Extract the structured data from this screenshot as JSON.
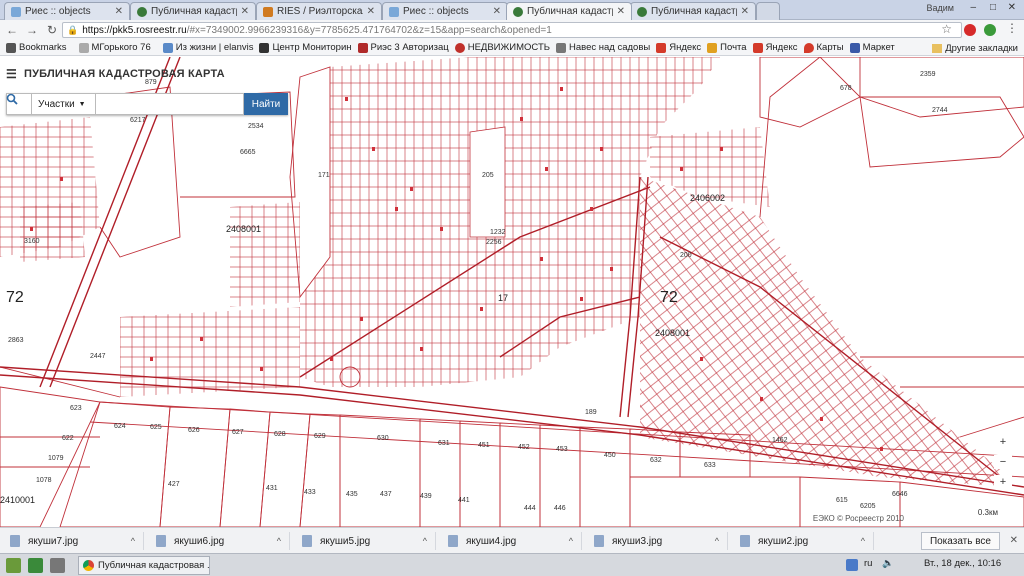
{
  "browser": {
    "tabs": [
      {
        "label": "Риес :: objects",
        "icon": "ries"
      },
      {
        "label": "Публичная кадастро",
        "icon": "rosreestr"
      },
      {
        "label": "RIES / Риэлторская и",
        "icon": "ries"
      },
      {
        "label": "Риес :: objects",
        "icon": "ries"
      },
      {
        "label": "Публичная кадастро",
        "icon": "rosreestr",
        "active": true
      },
      {
        "label": "Публичная кадастро",
        "icon": "rosreestr"
      }
    ],
    "user": "Вадим",
    "url_host": "https://pkk5.rosreestr.ru",
    "url_rest": "/#x=7349002.9966239316&y=7785625.471764702&z=15&app=search&opened=1",
    "bookmarks": [
      {
        "label": "Bookmarks",
        "icon": "apps-icon"
      },
      {
        "label": "МГорького 76",
        "icon": "doc-icon"
      },
      {
        "label": "Из жизни | elanvis",
        "icon": "blog-icon"
      },
      {
        "label": "Центр Мониторин",
        "icon": "monitor-icon"
      },
      {
        "label": "Риэс 3 Авторизац",
        "icon": "ries-icon"
      },
      {
        "label": "НЕДВИЖИМОСТЬ",
        "icon": "realty-icon"
      },
      {
        "label": "Навес над садовы",
        "icon": "tool-icon"
      },
      {
        "label": "Яндекс",
        "icon": "yandex-icon"
      },
      {
        "label": "Почта",
        "icon": "mail-icon"
      },
      {
        "label": "Яндекс",
        "icon": "yandex-icon"
      },
      {
        "label": "Карты",
        "icon": "maps-icon"
      },
      {
        "label": "Маркет",
        "icon": "market-icon"
      }
    ],
    "other_bookmarks": "Другие закладки"
  },
  "app": {
    "title": "ПУБЛИЧНАЯ КАДАСТРОВАЯ КАРТА",
    "search_type": "Участки",
    "search_value": "",
    "search_button": "Найти",
    "copyright": "ЕЭКО © Росреестр 2010",
    "scale": "0.3км",
    "zoom_in": "+",
    "zoom_out": "−",
    "zoom_extra": "+"
  },
  "map": {
    "labels": [
      {
        "text": "879",
        "k": "a"
      },
      {
        "text": "6217",
        "k": "b"
      },
      {
        "text": "2534",
        "k": "c"
      },
      {
        "text": "6665",
        "k": "d"
      },
      {
        "text": "171",
        "k": "e"
      },
      {
        "text": "205",
        "k": "f"
      },
      {
        "text": "2408001",
        "k": "g"
      },
      {
        "text": "2406002",
        "k": "h"
      },
      {
        "text": "200",
        "k": "i"
      },
      {
        "text": "17",
        "k": "j"
      },
      {
        "text": "2408001",
        "k": "k"
      },
      {
        "text": "2447",
        "k": "l"
      },
      {
        "text": "2863",
        "k": "m"
      },
      {
        "text": "2359",
        "k": "n"
      },
      {
        "text": "2744",
        "k": "o"
      },
      {
        "text": "678",
        "k": "p"
      },
      {
        "text": "623",
        "k": "q"
      },
      {
        "text": "624",
        "k": "r"
      },
      {
        "text": "625",
        "k": "s"
      },
      {
        "text": "626",
        "k": "t"
      },
      {
        "text": "627",
        "k": "u"
      },
      {
        "text": "628",
        "k": "v"
      },
      {
        "text": "629",
        "k": "w"
      },
      {
        "text": "630",
        "k": "x"
      },
      {
        "text": "631",
        "k": "y"
      },
      {
        "text": "451",
        "k": "z"
      },
      {
        "text": "452",
        "k": "aa"
      },
      {
        "text": "453",
        "k": "ab"
      },
      {
        "text": "450",
        "k": "ac"
      },
      {
        "text": "632",
        "k": "ad"
      },
      {
        "text": "633",
        "k": "ae"
      },
      {
        "text": "622",
        "k": "af"
      },
      {
        "text": "1079",
        "k": "ag"
      },
      {
        "text": "1078",
        "k": "ah"
      },
      {
        "text": "2410001",
        "k": "ai"
      },
      {
        "text": "427",
        "k": "aj"
      },
      {
        "text": "431",
        "k": "ak"
      },
      {
        "text": "433",
        "k": "al"
      },
      {
        "text": "435",
        "k": "am"
      },
      {
        "text": "437",
        "k": "an"
      },
      {
        "text": "439",
        "k": "ao"
      },
      {
        "text": "441",
        "k": "ap"
      },
      {
        "text": "444",
        "k": "aq"
      },
      {
        "text": "446",
        "k": "ar"
      },
      {
        "text": "189",
        "k": "as"
      },
      {
        "text": "1462",
        "k": "at"
      },
      {
        "text": "6646",
        "k": "au"
      },
      {
        "text": "6205",
        "k": "av"
      },
      {
        "text": "615",
        "k": "aw"
      },
      {
        "text": "1232",
        "k": "ax"
      },
      {
        "text": "2256",
        "k": "ay"
      },
      {
        "text": "3160",
        "k": "az"
      }
    ],
    "quarters": [
      {
        "text": "72",
        "k": "left"
      },
      {
        "text": "72",
        "k": "center"
      }
    ]
  },
  "downloads": {
    "items": [
      "якуши7.jpg",
      "якуши6.jpg",
      "якуши5.jpg",
      "якуши4.jpg",
      "якуши3.jpg",
      "якуши2.jpg"
    ],
    "show_all": "Показать все"
  },
  "taskbar": {
    "task_label": "Публичная кадастровая ...",
    "lang": "ru",
    "clock": "Вт., 18 дек., 10:16"
  },
  "colors": {
    "parcel_line": "#c0303a",
    "road": "#b01e28",
    "accent_button": "#2f6aa6"
  }
}
